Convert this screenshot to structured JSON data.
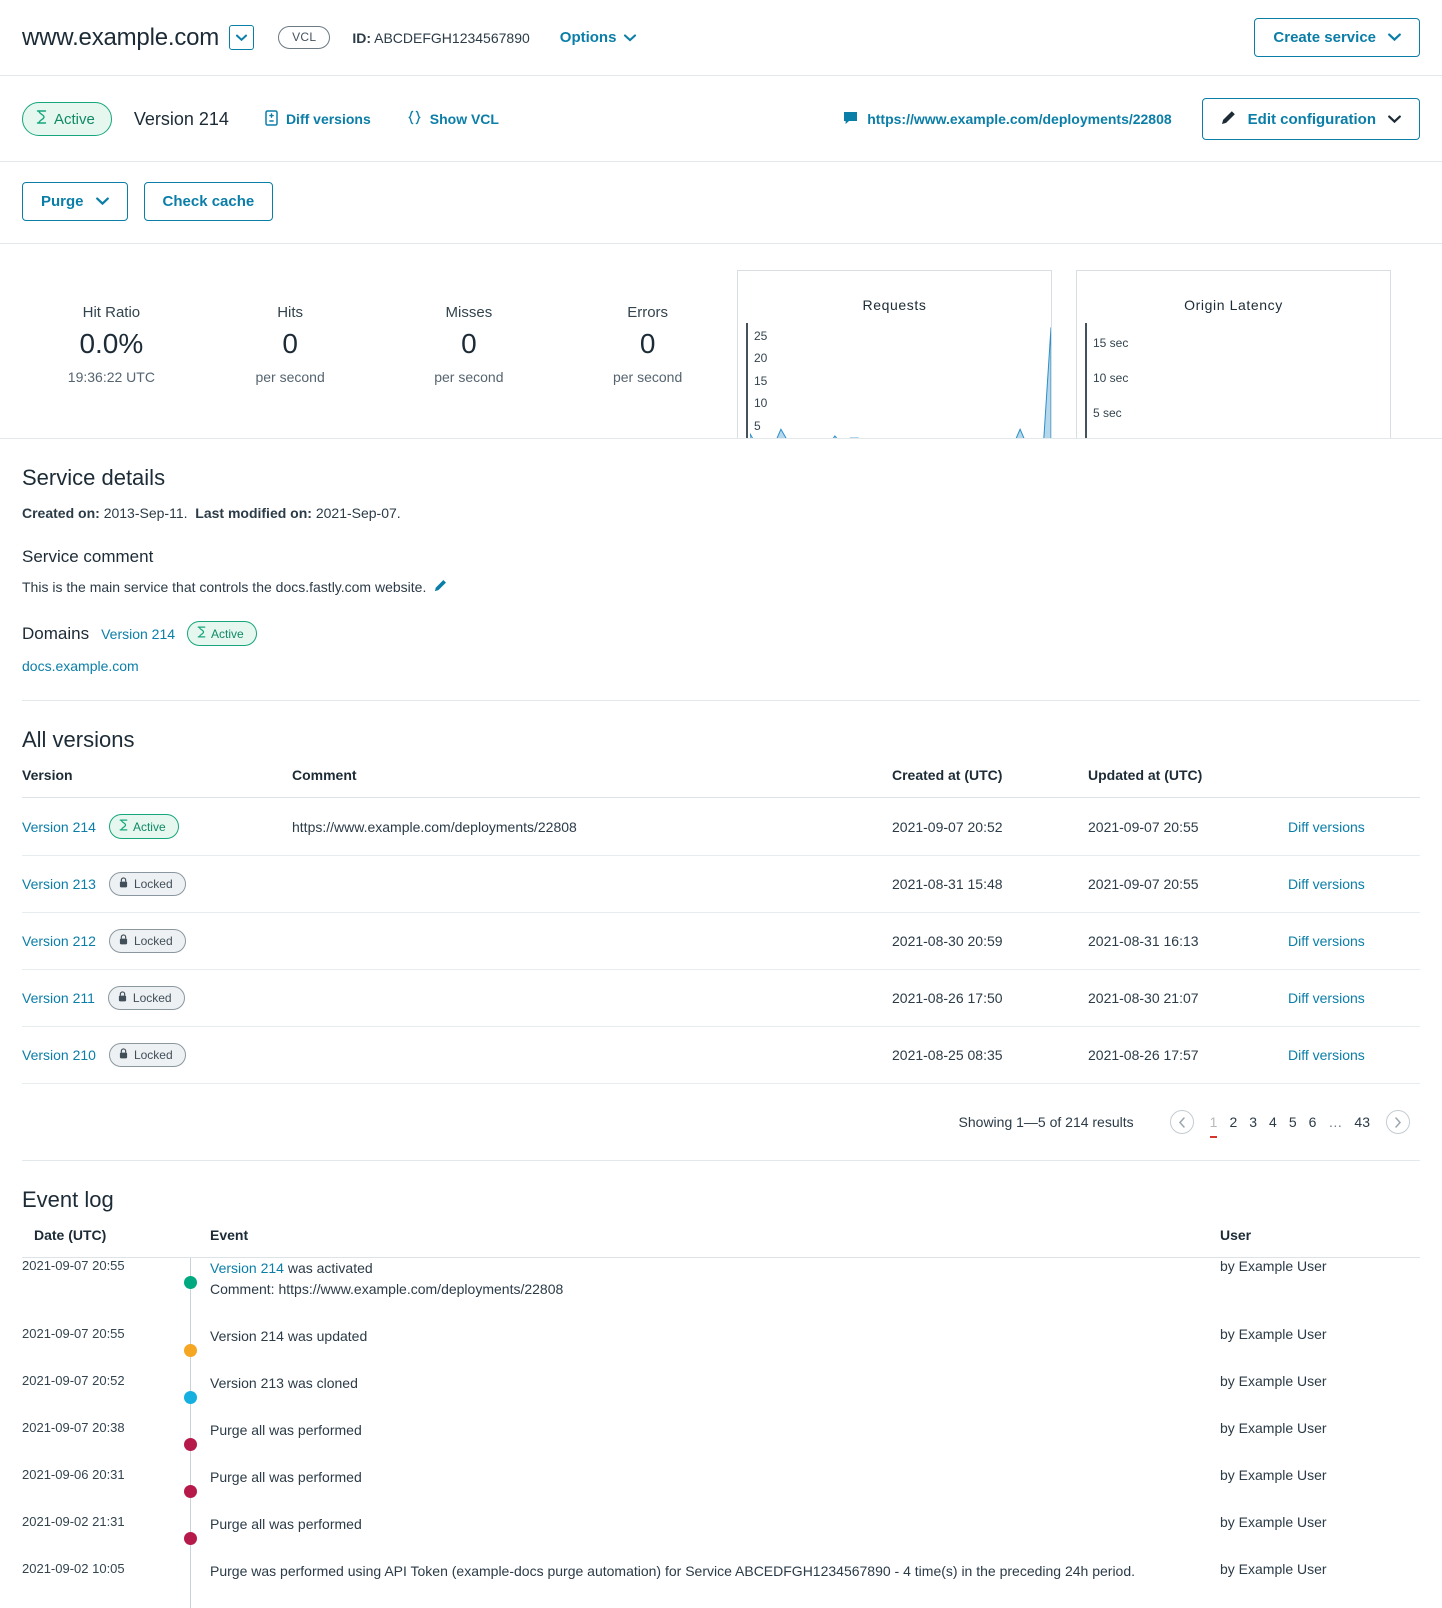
{
  "topbar": {
    "service_name": "www.example.com",
    "service_picker_icon": "chevron-down-icon",
    "vcl_pill": "VCL",
    "id_label": "ID:",
    "id_value": "ABCDEFGH1234567890",
    "options_label": "Options",
    "create_service_label": "Create service"
  },
  "versionbar": {
    "status_badge": "Active",
    "version_label": "Version 214",
    "diff_versions_label": "Diff versions",
    "show_vcl_label": "Show VCL",
    "deployment_url": "https://www.example.com/deployments/22808",
    "edit_configuration_label": "Edit configuration"
  },
  "actionbar": {
    "purge_label": "Purge",
    "check_cache_label": "Check cache"
  },
  "stats": [
    {
      "label": "Hit Ratio",
      "value": "0.0%",
      "sub": "19:36:22 UTC"
    },
    {
      "label": "Hits",
      "value": "0",
      "sub": "per second"
    },
    {
      "label": "Misses",
      "value": "0",
      "sub": "per second"
    },
    {
      "label": "Errors",
      "value": "0",
      "sub": "per second"
    }
  ],
  "chart_data": [
    {
      "type": "area",
      "title": "Requests",
      "xlabel": "",
      "ylabel": "",
      "ylim": [
        0,
        28
      ],
      "yticks": [
        5,
        10,
        15,
        20,
        25
      ],
      "ytick_labels": [
        "5",
        "10",
        "15",
        "20",
        "25"
      ],
      "grid": false,
      "legend": "none",
      "x": [
        0,
        1,
        2,
        3,
        4,
        5,
        6,
        7,
        8,
        9,
        10,
        11,
        12,
        13,
        14,
        15,
        16,
        17,
        18,
        19,
        20,
        21,
        22,
        23,
        24,
        25,
        26,
        27,
        28,
        29,
        30,
        31,
        32,
        33,
        34,
        35,
        36,
        37,
        38,
        39
      ],
      "values": [
        3,
        0,
        0,
        0,
        4,
        1,
        0,
        0,
        0,
        0,
        0,
        2.5,
        0.5,
        2,
        2,
        1.5,
        0,
        0,
        0,
        0,
        0,
        0,
        0,
        0,
        1,
        0,
        0,
        0,
        0,
        0,
        0,
        1,
        0,
        0,
        0,
        4,
        0,
        0,
        0,
        27
      ]
    },
    {
      "type": "bar",
      "title": "Origin Latency",
      "xlabel": "",
      "ylabel": "",
      "ylim": [
        0,
        18
      ],
      "yticks": [
        5,
        10,
        15
      ],
      "ytick_labels": [
        "5 sec",
        "10 sec",
        "15 sec"
      ],
      "grid": false,
      "legend": "none",
      "x": [
        0,
        1,
        2,
        3,
        4,
        5,
        6,
        7,
        8,
        9,
        10,
        11,
        12,
        13,
        14,
        15,
        16,
        17,
        18,
        19,
        20,
        21,
        22,
        23,
        24,
        25,
        26,
        27,
        28,
        29
      ],
      "values": [
        0,
        0,
        0,
        0,
        0,
        0,
        0,
        0,
        0,
        0,
        0,
        0,
        0,
        0,
        0,
        0,
        0,
        0,
        0,
        0,
        0,
        0.5,
        0.5,
        0,
        0,
        0.5,
        0,
        0.5,
        0.5,
        0
      ]
    }
  ],
  "service_details": {
    "heading": "Service details",
    "created_label": "Created on:",
    "created_value": "2013-Sep-11.",
    "modified_label": "Last modified on:",
    "modified_value": "2021-Sep-07.",
    "comment_heading": "Service comment",
    "comment_text": "This is the main service that controls the docs.fastly.com website.",
    "domains_heading": "Domains",
    "domains_version": "Version 214",
    "domains_status": "Active",
    "domain_items": [
      "docs.example.com"
    ]
  },
  "versions": {
    "heading": "All versions",
    "columns": [
      "Version",
      "Comment",
      "Created at (UTC)",
      "Updated at (UTC)",
      ""
    ],
    "rows": [
      {
        "version": "Version 214",
        "status": "Active",
        "status_kind": "active",
        "comment": "https://www.example.com/deployments/22808",
        "created": "2021-09-07 20:52",
        "updated": "2021-09-07 20:55",
        "action": "Diff versions"
      },
      {
        "version": "Version 213",
        "status": "Locked",
        "status_kind": "locked",
        "comment": "",
        "created": "2021-08-31 15:48",
        "updated": "2021-09-07 20:55",
        "action": "Diff versions"
      },
      {
        "version": "Version 212",
        "status": "Locked",
        "status_kind": "locked",
        "comment": "",
        "created": "2021-08-30 20:59",
        "updated": "2021-08-31 16:13",
        "action": "Diff versions"
      },
      {
        "version": "Version 211",
        "status": "Locked",
        "status_kind": "locked",
        "comment": "",
        "created": "2021-08-26 17:50",
        "updated": "2021-08-30 21:07",
        "action": "Diff versions"
      },
      {
        "version": "Version 210",
        "status": "Locked",
        "status_kind": "locked",
        "comment": "",
        "created": "2021-08-25 08:35",
        "updated": "2021-08-26 17:57",
        "action": "Diff versions"
      }
    ],
    "pagination": {
      "showing": "Showing 1—5 of 214 results",
      "prev_icon": "chevron-left-icon",
      "next_icon": "chevron-right-icon",
      "pages": [
        "1",
        "2",
        "3",
        "4",
        "5",
        "6",
        "…",
        "43"
      ],
      "current": "1"
    }
  },
  "event_log": {
    "heading": "Event log",
    "columns": [
      "Date (UTC)",
      "Event",
      "User"
    ],
    "rows": [
      {
        "date": "2021-09-07 20:55",
        "dot_color": "#00a97f",
        "event_link": "Version 214",
        "event_text": " was activated",
        "event_sub": "Comment: https://www.example.com/deployments/22808",
        "user": "by Example User"
      },
      {
        "date": "2021-09-07 20:55",
        "dot_color": "#f5a623",
        "event_link": "",
        "event_text": "Version 214 was updated",
        "event_sub": "",
        "user": "by Example User"
      },
      {
        "date": "2021-09-07 20:52",
        "dot_color": "#15b0e0",
        "event_link": "",
        "event_text": "Version 213 was cloned",
        "event_sub": "",
        "user": "by Example User"
      },
      {
        "date": "2021-09-07 20:38",
        "dot_color": "#b51a4b",
        "event_link": "",
        "event_text": "Purge all was performed",
        "event_sub": "",
        "user": "by Example User"
      },
      {
        "date": "2021-09-06 20:31",
        "dot_color": "#b51a4b",
        "event_link": "",
        "event_text": "Purge all was performed",
        "event_sub": "",
        "user": "by Example User"
      },
      {
        "date": "2021-09-02 21:31",
        "dot_color": "#b51a4b",
        "event_link": "",
        "event_text": "Purge all was performed",
        "event_sub": "",
        "user": "by Example User"
      },
      {
        "date": "2021-09-02 10:05",
        "dot_color": "",
        "event_link": "",
        "event_text": "Purge was performed using API Token (example-docs purge automation) for Service ABCEDFGH1234567890 - 4 time(s) in the preceding 24h period.",
        "event_sub": "",
        "user": "by Example User"
      }
    ]
  },
  "colors": {
    "link": "#0b7ea8",
    "active_green": "#15a77b",
    "chart_blue": "#2c8fc9",
    "current_page_underline": "#d6352b"
  }
}
